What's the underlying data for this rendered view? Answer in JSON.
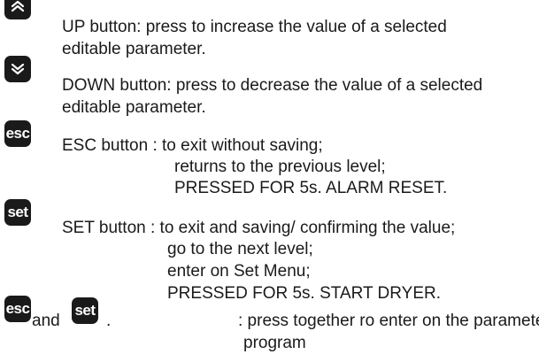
{
  "buttons": {
    "up": {
      "icon": "double-chevron-up-icon",
      "line1": "UP button: press to increase the value of a selected",
      "line2": "editable parameter."
    },
    "down": {
      "icon": "double-chevron-down-icon",
      "line1": "DOWN button: press to decrease the value of a selected",
      "line2": "editable parameter."
    },
    "esc": {
      "label": "esc",
      "line1": "ESC button : to exit without saving;",
      "line2": "returns to the previous level;",
      "line3": "PRESSED FOR 5s. ALARM RESET."
    },
    "set": {
      "label": "set",
      "line1": "SET button :  to exit and saving/ confirming the value;",
      "line2": "go to the next level;",
      "line3": "enter on Set Menu;",
      "line4": "PRESSED FOR 5s. START DRYER."
    },
    "combo": {
      "label1": "esc",
      "conjunction": "and",
      "label2": "set",
      "dot": ".",
      "line1": ": press together ro enter on the parameters",
      "line2": "program"
    }
  },
  "colors": {
    "button_bg": "#1a1a1a",
    "button_text": "#ffffff",
    "text": "#1a1a1a"
  }
}
